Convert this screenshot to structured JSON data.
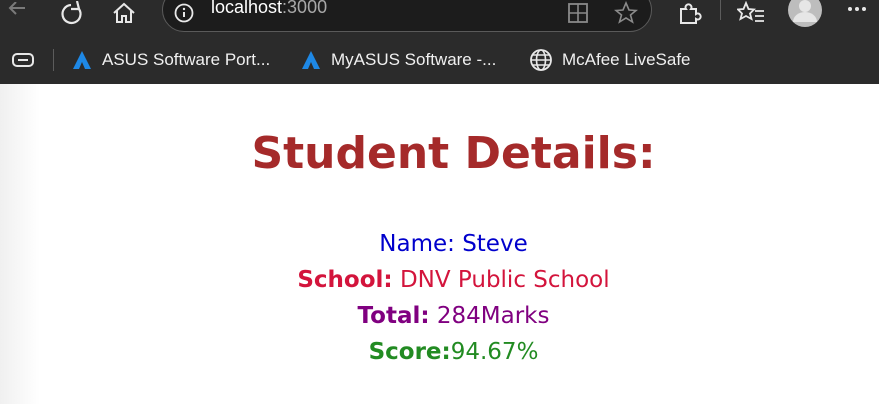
{
  "browser": {
    "address": {
      "host": "localhost",
      "port": ":3000"
    },
    "bookmarks": [
      {
        "label": "ASUS Software Port...",
        "icon": "asus-logo-icon"
      },
      {
        "label": "MyASUS Software -...",
        "icon": "asus-logo-icon"
      },
      {
        "label": "McAfee LiveSafe",
        "icon": "globe-icon"
      }
    ],
    "toolbar_icons": [
      "back-icon",
      "refresh-icon",
      "home-icon",
      "info-icon",
      "split-screen-icon",
      "favorite-icon",
      "extensions-icon",
      "favorites-list-icon",
      "profile-icon",
      "more-icon"
    ]
  },
  "page": {
    "title": "Student Details:",
    "details": {
      "name_label": "Name:",
      "name_value": "Steve",
      "school_label": "School:",
      "school_value": "DNV Public School",
      "total_label": "Total:",
      "total_value": "284Marks",
      "score_label": "Score:",
      "score_value": "94.67%"
    },
    "colors": {
      "title": "#a52a2a",
      "name": "#0000cc",
      "school": "#d3143c",
      "total": "#800080",
      "score": "#228b22"
    }
  }
}
